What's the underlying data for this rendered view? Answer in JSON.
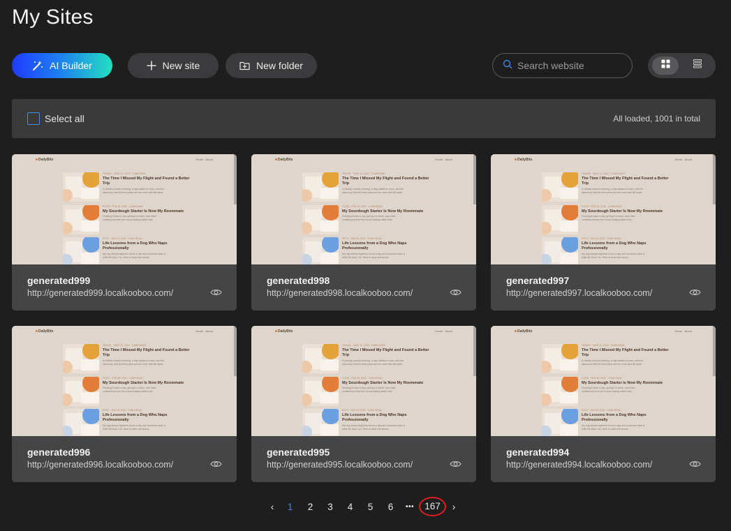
{
  "page": {
    "title": "My Sites"
  },
  "toolbar": {
    "ai_builder_label": "AI Builder",
    "new_site_label": "New site",
    "new_folder_label": "New folder",
    "search_placeholder": "Search website",
    "view_mode": "grid"
  },
  "select_bar": {
    "select_all_label": "Select all",
    "total_text": "All loaded, 1001 in total"
  },
  "thumbnail": {
    "logo": "DailyBits",
    "nav": [
      "Home",
      "About"
    ],
    "posts": [
      {
        "meta": "TRAVEL · MAR 12, 2024 · 5 MIN READ",
        "title": "The Time I Missed My Flight and Found a Better Trip",
        "excerpt": "A cheeky chance meeting, a day wasted in town, and the discovery that the best plans are the ones that fall apart."
      },
      {
        "meta": "FOOD · FEB 28, 2024 · 4 MIN READ",
        "title": "My Sourdough Starter Is Now My Roommate",
        "excerpt": "Feeding it twice a day, giving it a name, and other confessions from the house-baking rabbit hole."
      },
      {
        "meta": "PETS · JAN 15, 2024 · 3 MIN READ",
        "title": "Life Lessons from a Dog Who Naps Professionally",
        "excerpt": "My dog sleeps eighteen hours a day and somehow lives a fuller life than I do. Here is what she knows."
      }
    ]
  },
  "sites": [
    {
      "name": "generated999",
      "url": "http://generated999.localkooboo.com/"
    },
    {
      "name": "generated998",
      "url": "http://generated998.localkooboo.com/"
    },
    {
      "name": "generated997",
      "url": "http://generated997.localkooboo.com/"
    },
    {
      "name": "generated996",
      "url": "http://generated996.localkooboo.com/"
    },
    {
      "name": "generated995",
      "url": "http://generated995.localkooboo.com/"
    },
    {
      "name": "generated994",
      "url": "http://generated994.localkooboo.com/"
    }
  ],
  "pagination": {
    "prev": "‹",
    "pages": [
      "1",
      "2",
      "3",
      "4",
      "5",
      "6"
    ],
    "current": "1",
    "ellipsis": "•••",
    "last": "167",
    "next": "›"
  },
  "colors": {
    "background": "#1e1e1f",
    "accent": "#3d86e8",
    "highlight_circle": "#e11d1d"
  }
}
